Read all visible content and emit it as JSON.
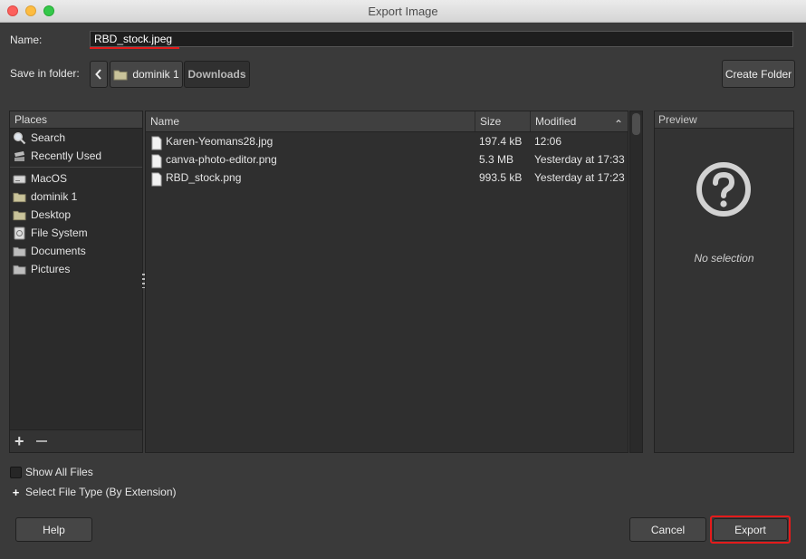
{
  "window": {
    "title": "Export Image"
  },
  "name_label": "Name:",
  "name_value": "RBD_stock.jpeg",
  "save_label": "Save in folder:",
  "breadcrumb": {
    "back_icon": "chevron-left-icon",
    "items": [
      "dominik 1",
      "Downloads"
    ]
  },
  "create_folder": "Create Folder",
  "places": {
    "header": "Places",
    "items": [
      {
        "label": "Search",
        "icon": "search-icon"
      },
      {
        "label": "Recently Used",
        "icon": "recent-icon"
      },
      {
        "label": "MacOS",
        "icon": "drive-icon"
      },
      {
        "label": "dominik 1",
        "icon": "home-folder-icon"
      },
      {
        "label": "Desktop",
        "icon": "folder-icon"
      },
      {
        "label": "File System",
        "icon": "filesystem-icon"
      },
      {
        "label": "Documents",
        "icon": "folder-icon"
      },
      {
        "label": "Pictures",
        "icon": "folder-icon"
      }
    ]
  },
  "files": {
    "columns": [
      "Name",
      "Size",
      "Modified"
    ],
    "rows": [
      {
        "name": "Karen-Yeomans28.jpg",
        "size": "197.4 kB",
        "modified": "12:06"
      },
      {
        "name": "canva-photo-editor.png",
        "size": "5.3 MB",
        "modified": "Yesterday at 17:33"
      },
      {
        "name": "RBD_stock.png",
        "size": "993.5 kB",
        "modified": "Yesterday at 17:23"
      }
    ]
  },
  "preview": {
    "header": "Preview",
    "text": "No selection"
  },
  "show_all_files": "Show All Files",
  "select_file_type": "Select File Type (By Extension)",
  "buttons": {
    "help": "Help",
    "cancel": "Cancel",
    "export": "Export"
  },
  "colors": {
    "highlight": "#e41b1b",
    "background": "#3a3a3a"
  }
}
